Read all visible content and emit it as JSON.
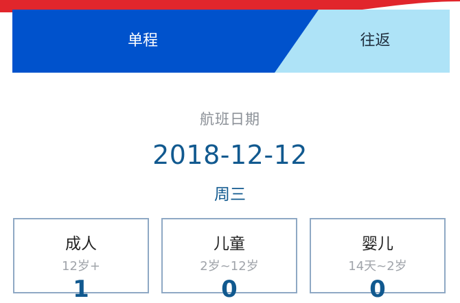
{
  "colors": {
    "banner_red": "#e1262c",
    "tab_active": "#0052cc",
    "tab_inactive": "#aee3f7",
    "accent_text": "#11598f"
  },
  "trip_tabs": {
    "oneway_label": "单程",
    "roundtrip_label": "往返",
    "selected": "oneway"
  },
  "flight_date": {
    "label": "航班日期",
    "value": "2018-12-12",
    "weekday": "周三"
  },
  "passengers": [
    {
      "type": "成人",
      "age_range": "12岁+",
      "count": "1"
    },
    {
      "type": "儿童",
      "age_range": "2岁~12岁",
      "count": "0"
    },
    {
      "type": "婴儿",
      "age_range": "14天~2岁",
      "count": "0"
    }
  ]
}
